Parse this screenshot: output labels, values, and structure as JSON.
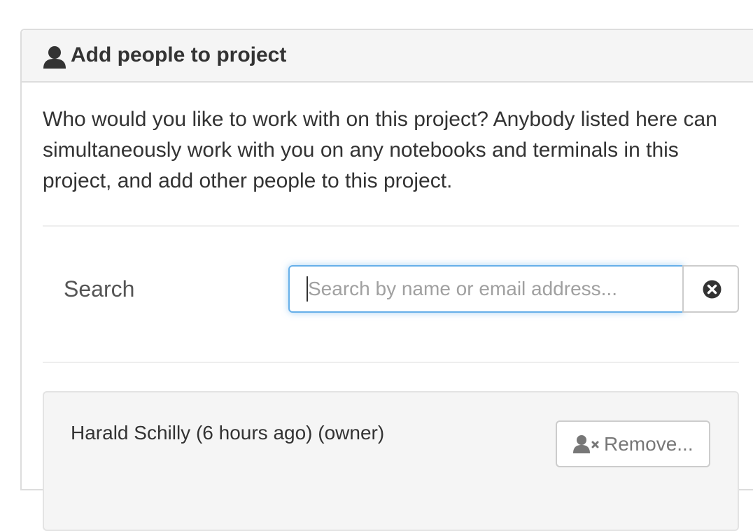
{
  "panel": {
    "title": "Add people to project",
    "title_icon": "user-icon",
    "description": "Who would you like to work with on this project? Anybody listed here can simultaneously work with you on any notebooks and terminals in this project, and add other people to this project."
  },
  "search": {
    "label": "Search",
    "placeholder": "Search by name or email address...",
    "value": "",
    "clear_icon": "times-circle-icon"
  },
  "collaborators": [
    {
      "name": "Harald Schilly (6 hours ago) (owner)",
      "remove_label": "Remove...",
      "remove_icon": "user-times-icon"
    }
  ],
  "colors": {
    "focus_border": "#66afe9",
    "heading_bg": "#f5f5f5",
    "text": "#333333"
  }
}
